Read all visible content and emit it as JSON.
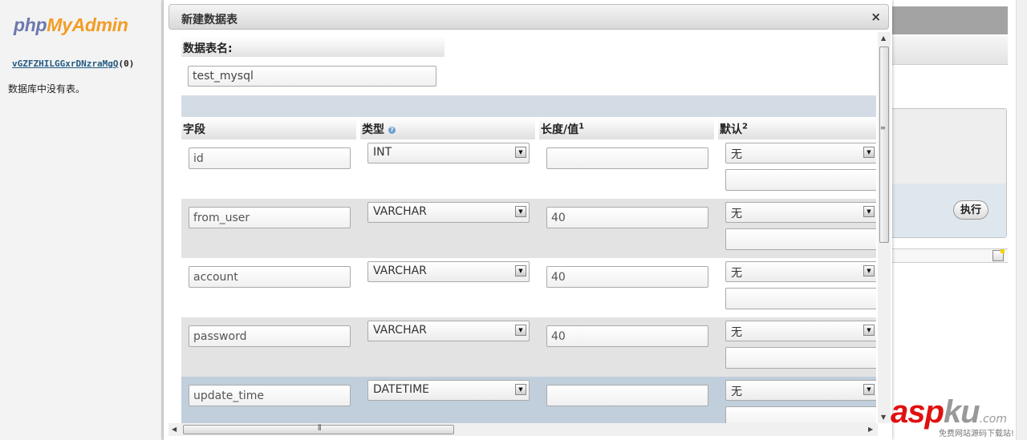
{
  "nav": {
    "logo_php": "php",
    "logo_myadmin": "MyAdmin",
    "db_link": "vGZFZHILGGxrDNzraMgQ",
    "db_count": "(0)",
    "no_tables": "数据库中没有表。"
  },
  "background": {
    "exec_button": "执行"
  },
  "dialog": {
    "title": "新建数据表",
    "close": "×",
    "table_name_label": "数据表名:",
    "table_name_value": "test_mysql",
    "columns": {
      "field": "字段",
      "type": "类型",
      "length": "长度/值",
      "length_sup": "1",
      "default": "默认",
      "default_sup": "2"
    },
    "rows": [
      {
        "field": "id",
        "type": "INT",
        "length": "",
        "default": "无"
      },
      {
        "field": "from_user",
        "type": "VARCHAR",
        "length": "40",
        "default": "无"
      },
      {
        "field": "account",
        "type": "VARCHAR",
        "length": "40",
        "default": "无"
      },
      {
        "field": "password",
        "type": "VARCHAR",
        "length": "40",
        "default": "无"
      },
      {
        "field": "update_time",
        "type": "DATETIME",
        "length": "",
        "default": "无"
      }
    ]
  },
  "watermark": {
    "brand_asp": "asp",
    "brand_ku": "ku",
    "brand_com": ".com",
    "subtitle": "免费网站源码下载站!"
  }
}
